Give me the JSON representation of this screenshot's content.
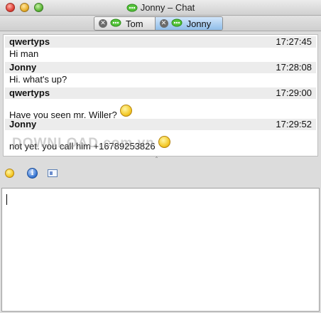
{
  "window": {
    "title": "Jonny – Chat"
  },
  "tabs": [
    {
      "label": "Tom",
      "active": false
    },
    {
      "label": "Jonny",
      "active": true
    }
  ],
  "messages": [
    {
      "sender": "qwertyps",
      "time": "17:27:45",
      "text": "Hi man",
      "emoji": false
    },
    {
      "sender": "Jonny",
      "time": "17:28:08",
      "text": "Hi. what's up?",
      "emoji": false
    },
    {
      "sender": "qwertyps",
      "time": "17:29:00",
      "text": "Have you seen mr. Willer?",
      "emoji": true
    },
    {
      "sender": "Jonny",
      "time": "17:29:52",
      "text": "not yet. you call him +16789253826",
      "emoji": true
    }
  ],
  "watermark": "DOWNLOAD.com.vn",
  "toolbar": {
    "icons": [
      "smiley-icon",
      "info-icon",
      "contact-card-icon"
    ]
  },
  "input": {
    "value": ""
  },
  "colors": {
    "accent_tab": "#8fbde9",
    "header_bg": "#ececec"
  }
}
